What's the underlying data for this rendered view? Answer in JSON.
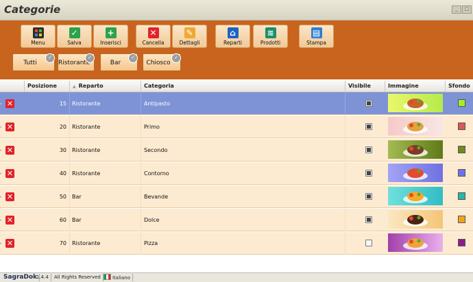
{
  "window": {
    "title": "Categorie"
  },
  "toolbar": [
    {
      "label": "Menu",
      "icon": "grid-icon",
      "color": "#2d2d2d"
    },
    {
      "label": "Salva",
      "icon": "check-icon",
      "color": "#2ca24a"
    },
    {
      "label": "Inserisci",
      "icon": "plus-icon",
      "color": "#2ca24a"
    },
    {
      "label": "Cancella",
      "icon": "close-icon",
      "color": "#e0232a"
    },
    {
      "label": "Dettagli",
      "icon": "edit-icon",
      "color": "#f0a833"
    },
    {
      "label": "Reparti",
      "icon": "store-icon",
      "color": "#1f63c2"
    },
    {
      "label": "Prodotti",
      "icon": "bread-icon",
      "color": "#1a8f6a"
    },
    {
      "label": "Stampa",
      "icon": "printer-icon",
      "color": "#2f7fd4"
    }
  ],
  "filters": [
    "Tutti",
    "Ristorante",
    "Bar",
    "Chiosco"
  ],
  "columns": [
    "Posizione",
    "Reparto",
    "Categoria",
    "Visibile",
    "Immagine",
    "Sfondo"
  ],
  "rows": [
    {
      "posizione": "15",
      "reparto": "Ristorante",
      "categoria": "Antipasto",
      "visibile": true,
      "sfondo": "#a6ec2d",
      "img_bg": [
        "#eaf76a",
        "#b6ea4c"
      ],
      "food": "#c7642a",
      "selected": true
    },
    {
      "posizione": "20",
      "reparto": "Ristorante",
      "categoria": "Primo",
      "visibile": true,
      "sfondo": "#d9585a",
      "img_bg": [
        "#f6c9c8",
        "#f7e7e6"
      ],
      "food": "#e2a43f",
      "selected": false
    },
    {
      "posizione": "30",
      "reparto": "Ristorante",
      "categoria": "Secondo",
      "visibile": true,
      "sfondo": "#6e8a1f",
      "img_bg": [
        "#a3bb52",
        "#5f7a19"
      ],
      "food": "#7d3b27",
      "selected": false
    },
    {
      "posizione": "40",
      "reparto": "Ristorante",
      "categoria": "Contorno",
      "visibile": true,
      "sfondo": "#6f72e6",
      "img_bg": [
        "#a2a4f5",
        "#6f71e1"
      ],
      "food": "#e34c30",
      "selected": false
    },
    {
      "posizione": "50",
      "reparto": "Bar",
      "categoria": "Bevande",
      "visibile": true,
      "sfondo": "#27b7a6",
      "img_bg": [
        "#6fe0dd",
        "#31bcc4"
      ],
      "food": "#f7a928",
      "selected": false
    },
    {
      "posizione": "60",
      "reparto": "Bar",
      "categoria": "Dolce",
      "visibile": true,
      "sfondo": "#f0a21e",
      "img_bg": [
        "#fbe7c2",
        "#f5c576"
      ],
      "food": "#4a2414",
      "selected": false
    },
    {
      "posizione": "70",
      "reparto": "Ristorante",
      "categoria": "Pizza",
      "visibile": false,
      "sfondo": "#8e1a8e",
      "img_bg": [
        "#a23fa9",
        "#e9b1ec"
      ],
      "food": "#f0a23a",
      "selected": false
    }
  ],
  "status": {
    "app": "SagraDok",
    "version": "1.4.4",
    "rights": "All Rights Reserved",
    "language": "Italiano"
  }
}
